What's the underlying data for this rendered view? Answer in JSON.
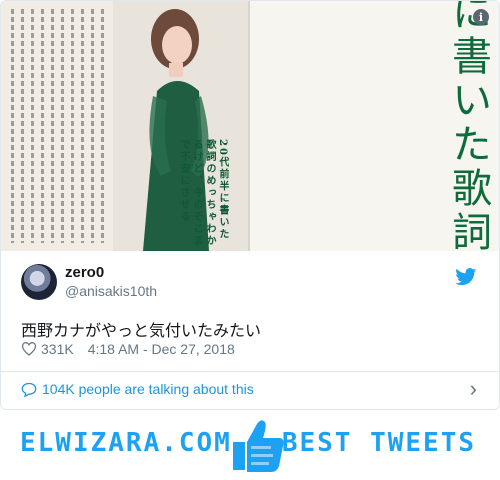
{
  "media": {
    "alt": "Magazine page photo with vertical Japanese text",
    "right_page_text": "に書いた歌詞のわかるけど、今の不安にさせる人",
    "left_page_snippet": "20代前半に書いた歌詞のめっちゃわかるけど、今のそこまで不安にさせる",
    "info_icon": "i"
  },
  "tweet": {
    "display_name": "zero0",
    "handle": "@anisakis10th",
    "text": "西野カナがやっと気付いたみたい",
    "likes": "331K",
    "timestamp": "4:18 AM - Dec 27, 2018",
    "talking": "104K people are talking about this"
  },
  "footer": {
    "left_brand": "ELWIZARA.COM",
    "right_brand": "BEST TWEETS"
  },
  "colors": {
    "accent": "#1da1f2",
    "link": "#1b95e0",
    "muted": "#657786",
    "text": "#14171a",
    "green_print": "#0f6a3c"
  }
}
